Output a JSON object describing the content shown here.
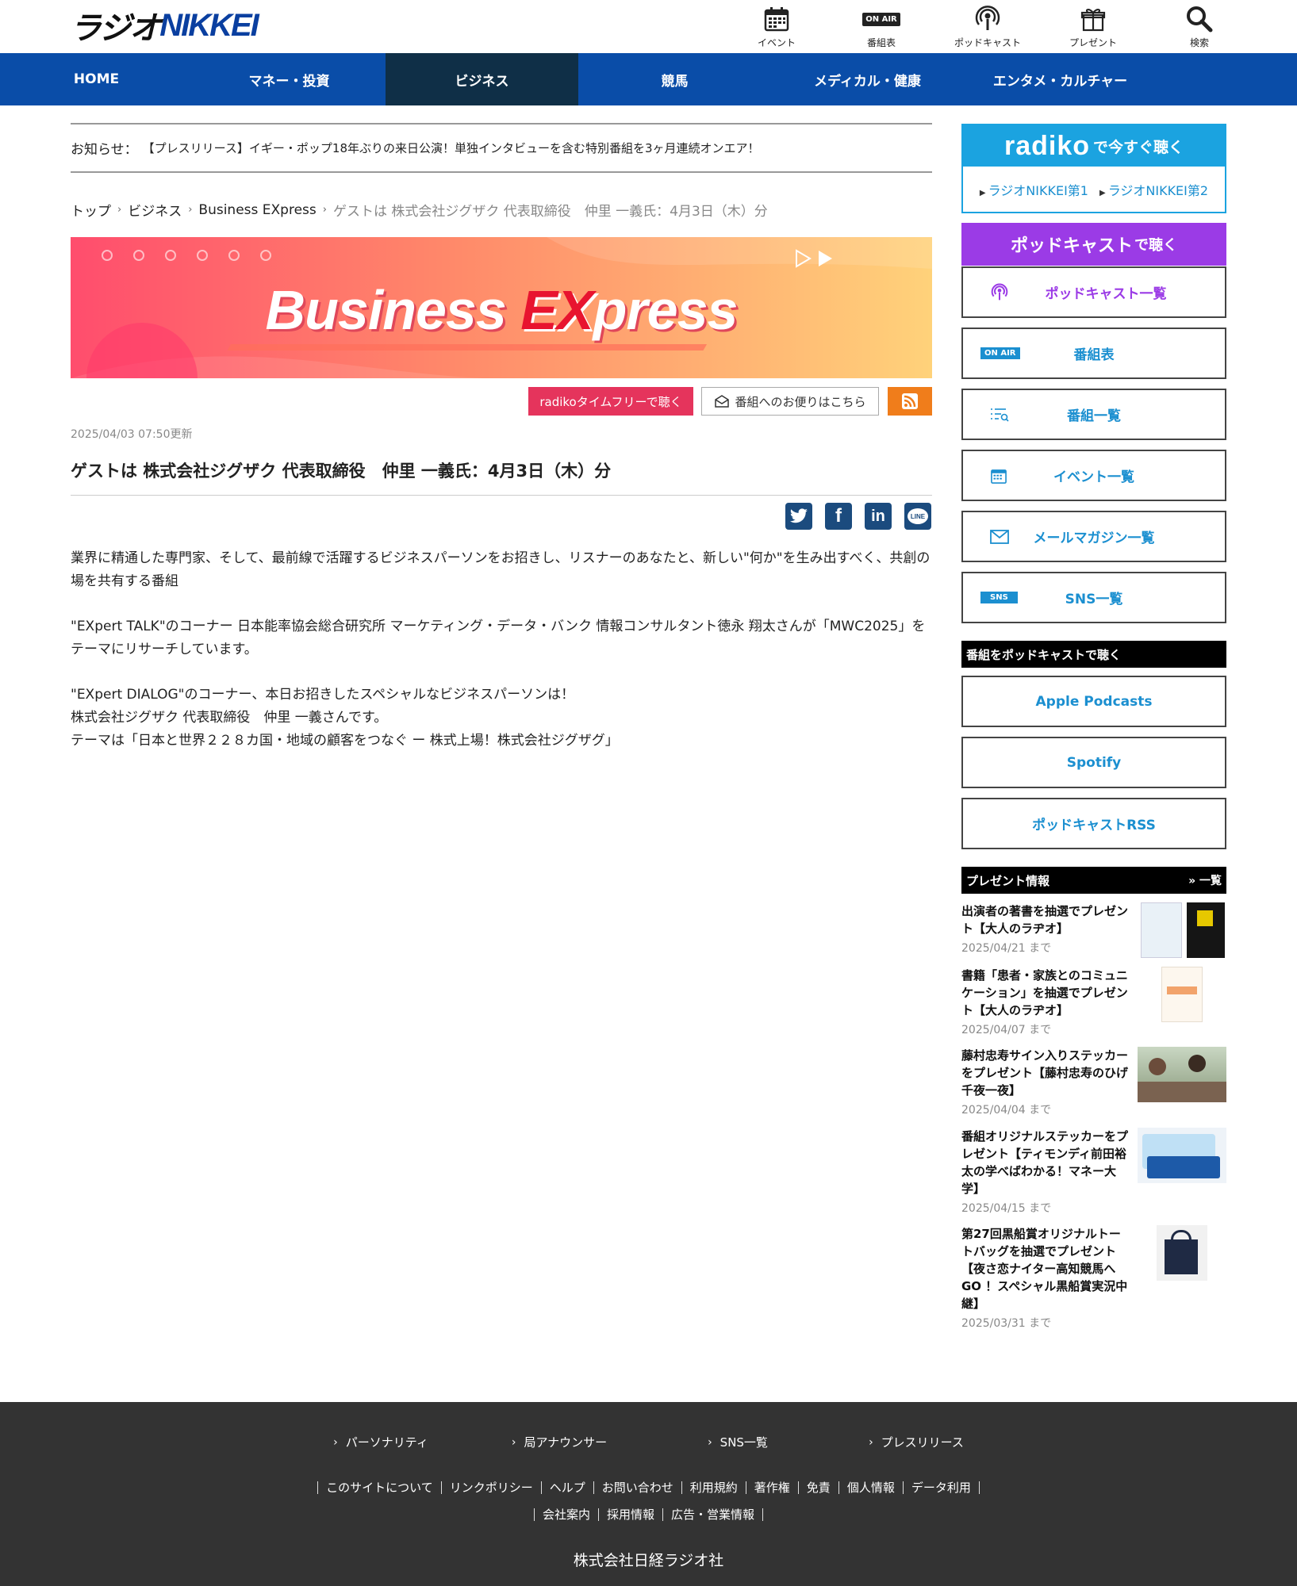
{
  "header": {
    "logo_part1": "ラジオ",
    "logo_part2": "NIKKEI",
    "nav": [
      {
        "label": "イベント",
        "icon": "calendar-icon"
      },
      {
        "label": "番組表",
        "icon": "on-air-icon",
        "badge": "ON AIR"
      },
      {
        "label": "ポッドキャスト",
        "icon": "podcast-icon"
      },
      {
        "label": "プレゼント",
        "icon": "gift-icon"
      },
      {
        "label": "検索",
        "icon": "search-icon"
      }
    ]
  },
  "global_nav": [
    {
      "label": "HOME"
    },
    {
      "label": "マネー・投資"
    },
    {
      "label": "ビジネス"
    },
    {
      "label": "競馬"
    },
    {
      "label": "メディカル・健康"
    },
    {
      "label": "エンタメ・カルチャー"
    }
  ],
  "notice": {
    "label": "お知らせ：",
    "text": "【プレスリリース】イギー・ポップ18年ぶりの来日公演！単独インタビューを含む特別番組を3ヶ月連続オンエア！"
  },
  "breadcrumb": {
    "items": [
      "トップ",
      "ビジネス",
      "Business EXpress"
    ],
    "current": "ゲストは 株式会社ジグザク 代表取締役　仲里 一義氏：4月3日（木）分"
  },
  "banner": {
    "title_a": "Business ",
    "title_b": "EX",
    "title_c": "press"
  },
  "actions": {
    "radiko_label": "radikoタイムフリーで聴く",
    "mail_label": "番組へのお便りはこちら",
    "rss_icon": "rss-icon"
  },
  "article": {
    "updated": "2025/04/03 07:50更新",
    "title": "ゲストは 株式会社ジグザク 代表取締役　仲里 一義氏：4月3日（木）分",
    "para1": "業界に精通した専門家、そして、最前線で活躍するビジネスパーソンをお招きし、リスナーのあなたと、新しい\"何か\"を生み出すべく、共創の場を共有する番組",
    "para2": "\"EXpert TALK\"のコーナー 日本能率協会総合研究所 マーケティング・データ・バンク 情報コンサルタント徳永 翔太さんが「MWC2025」をテーマにリサーチしています。",
    "para3_line1": "\"EXpert DIALOG\"のコーナー、本日お招きしたスペシャルなビジネスパーソンは！",
    "para3_line2": "株式会社ジグザク 代表取締役　仲里 一義さんです。",
    "para3_line3": "テーマは「日本と世界２２８カ国・地域の顧客をつなぐ ー 株式上場！株式会社ジグザグ」"
  },
  "share": {
    "twitter": "twitter-icon",
    "facebook": "facebook-icon",
    "linkedin": "linkedin-icon",
    "line": "line-icon",
    "line_text": "LINE",
    "linkedin_text": "in",
    "facebook_text": "f"
  },
  "sidebar": {
    "radiko_logo": "radiko",
    "radiko_suffix": "で今すぐ聴く",
    "radiko_link1": "ラジオNIKKEI第1",
    "radiko_link2": "ラジオNIKKEI第2",
    "podcast_head_a": "ポッドキャスト",
    "podcast_head_b": "で聴く",
    "buttons": [
      {
        "label": "ポッドキャスト一覧",
        "icon": "podcast-icon"
      },
      {
        "label": "番組表",
        "icon": "on-air-icon",
        "badge": "ON AIR"
      },
      {
        "label": "番組一覧",
        "icon": "program-list-icon"
      },
      {
        "label": "イベント一覧",
        "icon": "calendar-icon"
      },
      {
        "label": "メールマガジン一覧",
        "icon": "mail-icon"
      },
      {
        "label": "SNS一覧",
        "icon": "sns-icon",
        "badge": "SNS"
      }
    ],
    "podcast_section_head": "番組をポッドキャストで聴く",
    "podcast_links": [
      "Apple Podcasts",
      "Spotify",
      "ポッドキャストRSS"
    ],
    "present_head": "プレゼント情報",
    "present_more": "一覧",
    "presents": [
      {
        "title": "出演者の著書を抽選でプレゼント【大人のラヂオ】",
        "date": "2025/04/21 まで"
      },
      {
        "title": "書籍「患者・家族とのコミュニケーション」を抽選でプレゼント【大人のラヂオ】",
        "date": "2025/04/07 まで"
      },
      {
        "title": "藤村忠寿サイン入りステッカーをプレゼント【藤村忠寿のひげ千夜一夜】",
        "date": "2025/04/04 まで"
      },
      {
        "title": "番組オリジナルステッカーをプレゼント【ティモンディ前田裕太の学べばわかる！マネー大学】",
        "date": "2025/04/15 まで"
      },
      {
        "title": "第27回黒船賞オリジナルトートバッグを抽選でプレゼント【夜さ恋ナイター高知競馬へGO ！スペシャル黒船賞実況中継】",
        "date": "2025/03/31 まで"
      }
    ]
  },
  "footer": {
    "row1": [
      "パーソナリティ",
      "局アナウンサー",
      "SNS一覧",
      "プレスリリース"
    ],
    "row2": [
      "このサイトについて",
      "リンクポリシー",
      "ヘルプ",
      "お問い合わせ",
      "利用規約",
      "著作権",
      "免責",
      "個人情報",
      "データ利用"
    ],
    "row3": [
      "会社案内",
      "採用情報",
      "広告・営業情報"
    ],
    "copyright": "株式会社日経ラジオ社"
  },
  "colors": {
    "nav_blue": "#0a4da8",
    "nav_active": "#0f2f47",
    "radiko_blue": "#1ba3e0",
    "podcast_purple": "#9b3be6",
    "radiko_red": "#e5345c",
    "rss_orange": "#f07d1b",
    "footer_bg": "#333333"
  }
}
